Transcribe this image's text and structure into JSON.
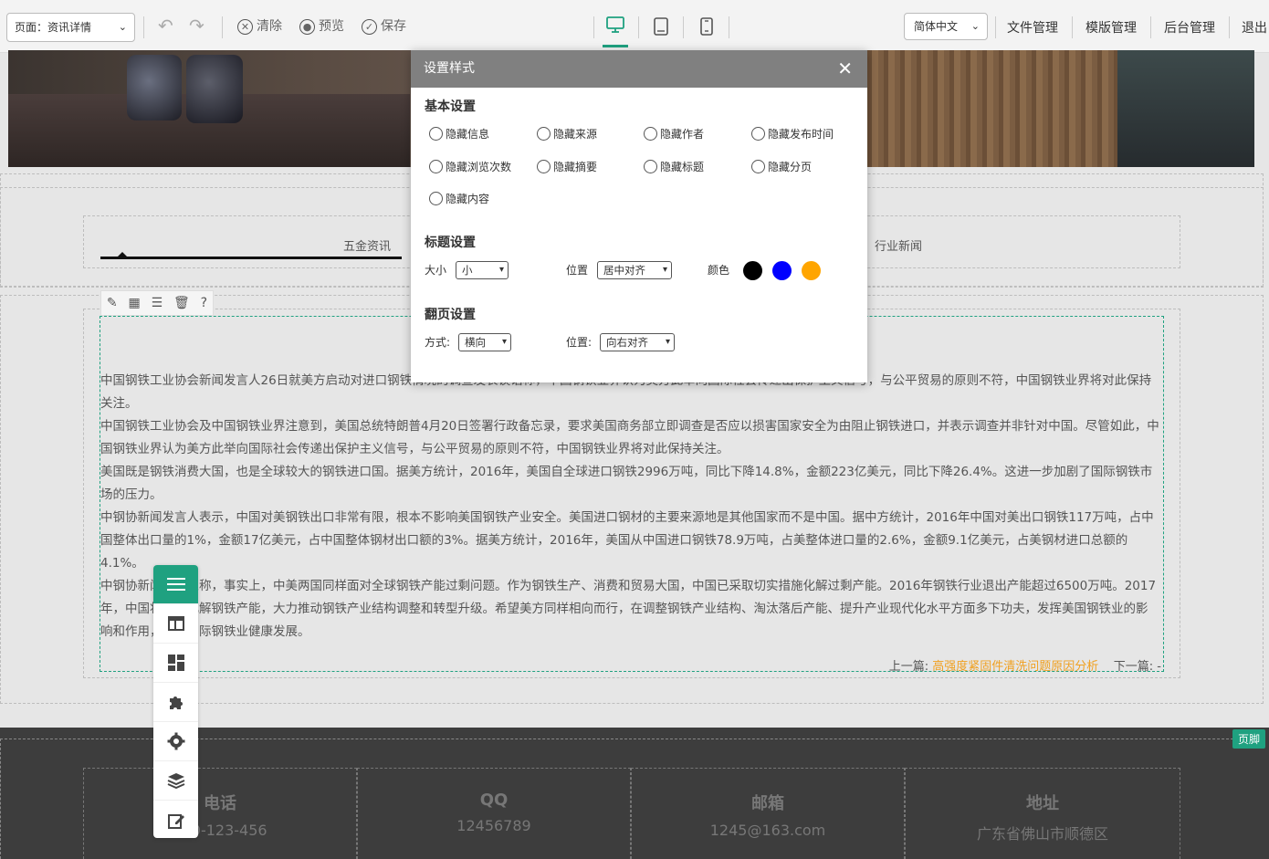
{
  "toolbar": {
    "page_select": "页面：资讯详情",
    "undo": "↶",
    "redo": "↷",
    "clear_label": "清除",
    "preview_label": "预览",
    "save_label": "保存",
    "language": "简体中文",
    "links": [
      "文件管理",
      "模版管理",
      "后台管理",
      "退出"
    ]
  },
  "tabs": {
    "left": "五金资讯",
    "right": "行业新闻"
  },
  "article": {
    "paragraphs": [
      "中国钢铁工业协会新闻发言人26日就美方启动对进口钢铁情况的调查发表谈话称，中国钢铁业界认为美方此举向国际社会传递出保护主义信号，与公平贸易的原则不符，中国钢铁业界将对此保持关注。",
      "中国钢铁工业协会及中国钢铁业界注意到，美国总统特朗普4月20日签署行政备忘录，要求美国商务部立即调查是否应以损害国家安全为由阻止钢铁进口，并表示调查并非针对中国。尽管如此，中国钢铁业界认为美方此举向国际社会传递出保护主义信号，与公平贸易的原则不符，中国钢铁业界将对此保持关注。",
      "美国既是钢铁消费大国，也是全球较大的钢铁进口国。据美方统计，2016年，美国自全球进口钢铁2996万吨，同比下降14.8%，金额223亿美元，同比下降26.4%。这进一步加剧了国际钢铁市场的压力。",
      "中钢协新闻发言人表示，中国对美钢铁出口非常有限，根本不影响美国钢铁产业安全。美国进口钢材的主要来源地是其他国家而不是中国。据中方统计，2016年中国对美出口钢铁117万吨，占中国整体出口量的1%，金额17亿美元，占中国整体钢材出口额的3%。据美方统计，2016年，美国从中国进口钢铁78.9万吨，占美整体进口量的2.6%，金额9.1亿美元，占美钢材进口总额的4.1%。",
      "中钢协新闻发言人称，事实上，中美两国同样面对全球钢铁产能过剩问题。作为钢铁生产、消费和贸易大国，中国已采取切实措施化解过剩产能。2016年钢铁行业退出产能超过6500万吨。2017年，中国将继续化解钢铁产能，大力推动钢铁产业结构调整和转型升级。希望美方同样相向而行，在调整钢铁产业结构、淘汰落后产能、提升产业现代化水平方面多下功夫，发挥美国钢铁业的影响和作用，促进国际钢铁业健康发展。"
    ],
    "prev_label": "上一篇:",
    "prev_link": "高强度紧固件清洗问题原因分析",
    "next_label": "下一篇:",
    "next_link": "-"
  },
  "footer": {
    "badge": "页脚",
    "columns": [
      {
        "title": "电话",
        "value": "020-123-456"
      },
      {
        "title": "QQ",
        "value": "12456789"
      },
      {
        "title": "邮箱",
        "value": "1245@163.com"
      },
      {
        "title": "地址",
        "value": "广东省佛山市顺德区"
      }
    ]
  },
  "dialog": {
    "title": "设置样式",
    "close": "✕",
    "basic_title": "基本设置",
    "radios": [
      "隐藏信息",
      "隐藏来源",
      "隐藏作者",
      "隐藏发布时间",
      "隐藏浏览次数",
      "隐藏摘要",
      "隐藏标题",
      "隐藏分页",
      "隐藏内容"
    ],
    "title_settings": "标题设置",
    "size_label": "大小",
    "size_value": "小",
    "pos_label": "位置",
    "pos_value": "居中对齐",
    "color_label": "颜色",
    "colors": [
      "#000000",
      "#0000ff",
      "#ffa500"
    ],
    "paging_title": "翻页设置",
    "mode_label": "方式:",
    "mode_value": "横向",
    "paging_pos_label": "位置:",
    "paging_pos_value": "向右对齐"
  },
  "accent_color": "#1fa180"
}
